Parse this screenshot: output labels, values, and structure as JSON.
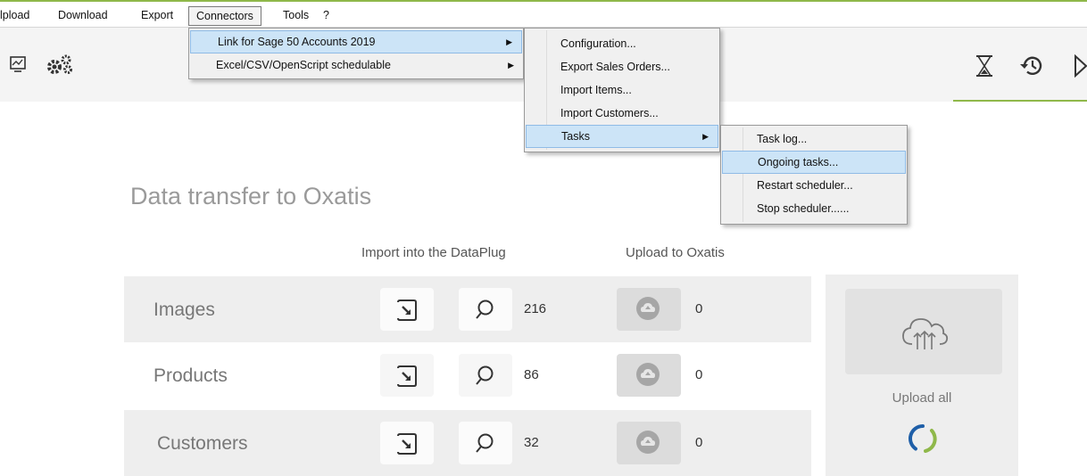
{
  "menubar": {
    "items": [
      "lpload",
      "Download",
      "Export",
      "Connectors",
      "Tools",
      "?"
    ]
  },
  "connectors_menu": {
    "items": [
      {
        "label": "Link for Sage 50 Accounts 2019",
        "submenu": true
      },
      {
        "label": "Excel/CSV/OpenScript schedulable",
        "submenu": true
      }
    ]
  },
  "sage_submenu": {
    "items": [
      {
        "label": "Configuration..."
      },
      {
        "label": "Export Sales Orders..."
      },
      {
        "label": "Import Items..."
      },
      {
        "label": "Import Customers..."
      },
      {
        "label": "Tasks",
        "submenu": true
      }
    ]
  },
  "tasks_submenu": {
    "items": [
      {
        "label": "Task log..."
      },
      {
        "label": "Ongoing tasks..."
      },
      {
        "label": "Restart scheduler..."
      },
      {
        "label": "Stop scheduler......"
      }
    ]
  },
  "main": {
    "title": "Data transfer to Oxatis",
    "col_import": "Import into the DataPlug",
    "col_upload": "Upload to Oxatis",
    "rows": [
      {
        "label": "Images",
        "count": "216",
        "upload_count": "0"
      },
      {
        "label": "Products",
        "count": "86",
        "upload_count": "0"
      },
      {
        "label": "Customers",
        "count": "32",
        "upload_count": "0"
      }
    ],
    "upload_all": "Upload all"
  },
  "colors": {
    "accent_green": "#8fb84a",
    "spinner_blue": "#1f5fa8",
    "highlight": "#cce4f7"
  }
}
